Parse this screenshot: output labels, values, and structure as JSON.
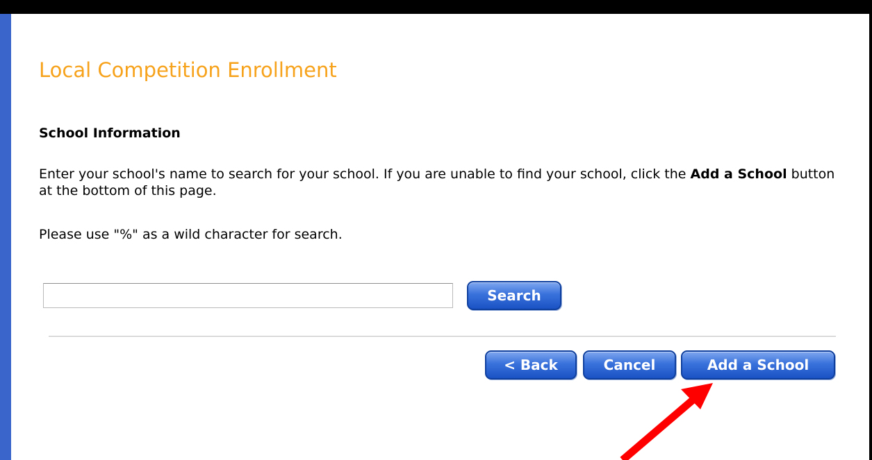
{
  "page": {
    "title": "Local Competition Enrollment"
  },
  "school_info": {
    "heading": "School Information",
    "instructions_part1": "Enter your school's name to search for your school. If you are unable to find your school, click the ",
    "instructions_bold": "Add a School",
    "instructions_part2": " button at the bottom of this page.",
    "wildcard_note": "Please use \"%\" as a wild character for search."
  },
  "search": {
    "value": "",
    "placeholder": "",
    "button_label": "Search"
  },
  "actions": {
    "back_label": "< Back",
    "cancel_label": "Cancel",
    "add_school_label": "Add a School"
  },
  "annotation": {
    "arrow_color": "#ff0000",
    "arrow_target": "add-a-school-button"
  },
  "colors": {
    "title": "#f7a21b",
    "left_bar": "#3a66cc",
    "button_fill": "#2f63d0"
  }
}
